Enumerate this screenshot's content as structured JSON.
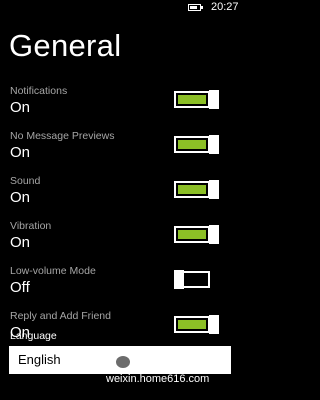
{
  "status_bar": {
    "time": "20:27"
  },
  "page": {
    "title": "General"
  },
  "settings": [
    {
      "label": "Notifications",
      "value": "On",
      "state": true
    },
    {
      "label": "No Message Previews",
      "value": "On",
      "state": true
    },
    {
      "label": "Sound",
      "value": "On",
      "state": true
    },
    {
      "label": "Vibration",
      "value": "On",
      "state": true
    },
    {
      "label": "Low-volume Mode",
      "value": "Off",
      "state": false
    },
    {
      "label": "Reply and Add Friend",
      "value": "On",
      "state": true
    }
  ],
  "language": {
    "label": "Language",
    "selected": "English"
  },
  "watermark": {
    "text": "weixin.home616.com"
  },
  "colors": {
    "accent": "#8cbf26",
    "background": "#000000",
    "secondary_text": "#a6a6a6"
  },
  "icons": {
    "status_battery": "battery-icon",
    "watermark": "wechat-icon"
  }
}
